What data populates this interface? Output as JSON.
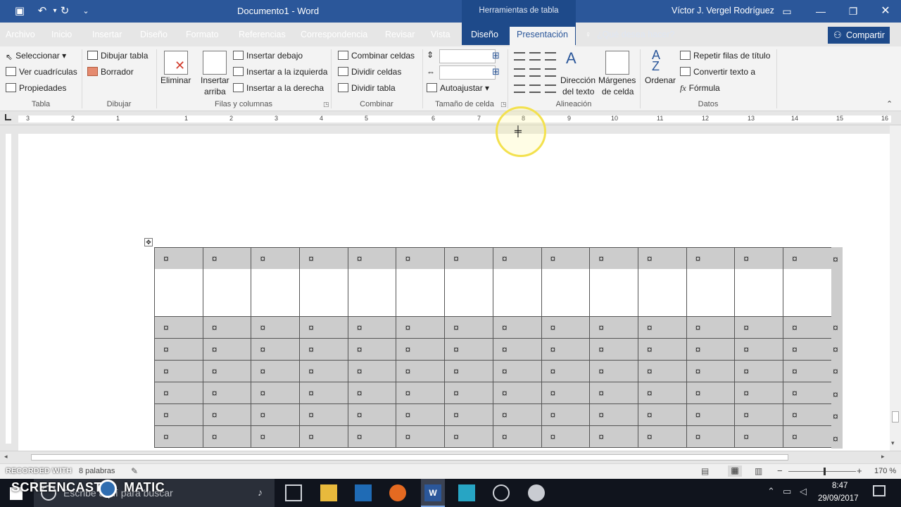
{
  "title_bar": {
    "document": "Documento1  -  Word",
    "context_tools": "Herramientas de tabla",
    "user": "Víctor J. Vergel Rodríguez"
  },
  "tabs": [
    {
      "label": "Archivo"
    },
    {
      "label": "Inicio"
    },
    {
      "label": "Insertar"
    },
    {
      "label": "Diseño"
    },
    {
      "label": "Formato"
    },
    {
      "label": "Referencias"
    },
    {
      "label": "Correspondencia"
    },
    {
      "label": "Revisar"
    },
    {
      "label": "Vista"
    },
    {
      "label": "Diseño"
    },
    {
      "label": "Presentación"
    }
  ],
  "tell_me": "¿Qué desea hacer?",
  "share": "Compartir",
  "ribbon": {
    "tabla": {
      "select": "Seleccionar",
      "gridlines": "Ver cuadrículas",
      "properties": "Propiedades",
      "group": "Tabla"
    },
    "dibujar": {
      "draw_table": "Dibujar tabla",
      "eraser": "Borrador",
      "group": "Dibujar"
    },
    "filas": {
      "delete": "Eliminar",
      "insert_above_1": "Insertar",
      "insert_above_2": "arriba",
      "insert_below": "Insertar debajo",
      "insert_left": "Insertar a la izquierda",
      "insert_right": "Insertar a la derecha",
      "group": "Filas y columnas"
    },
    "combinar": {
      "merge": "Combinar celdas",
      "split_cells": "Dividir celdas",
      "split_table": "Dividir tabla",
      "group": "Combinar"
    },
    "tamano": {
      "autofit": "Autoajustar",
      "group": "Tamaño de celda"
    },
    "alineacion": {
      "direction_1": "Dirección",
      "direction_2": "del texto",
      "margins_1": "Márgenes",
      "margins_2": "de celda",
      "group": "Alineación"
    },
    "datos": {
      "sort": "Ordenar",
      "repeat": "Repetir filas de título",
      "convert": "Convertir texto a",
      "formula": "Fórmula",
      "group": "Datos"
    }
  },
  "ruler": [
    "3",
    "2",
    "1",
    "1",
    "2",
    "3",
    "4",
    "5",
    "6",
    "7",
    "8",
    "9",
    "10",
    "11",
    "12",
    "13",
    "14",
    "15",
    "16"
  ],
  "table": {
    "cell_mark": "¤",
    "columns": 14,
    "rows_after_blank": 6
  },
  "status": {
    "words": "8 palabras",
    "zoom": "170 %",
    "recorded": "RECORDED WITH"
  },
  "watermark": "SCREENCAST",
  "watermark2": "MATIC",
  "taskbar": {
    "search": "Escribe aquí para buscar",
    "time": "8:47",
    "date": "29/09/2017"
  },
  "colors": {
    "word_blue": "#2b579a",
    "context_blue": "#1e4a8a",
    "cell_gray": "#cccccc",
    "highlight": "#f3e14e"
  }
}
